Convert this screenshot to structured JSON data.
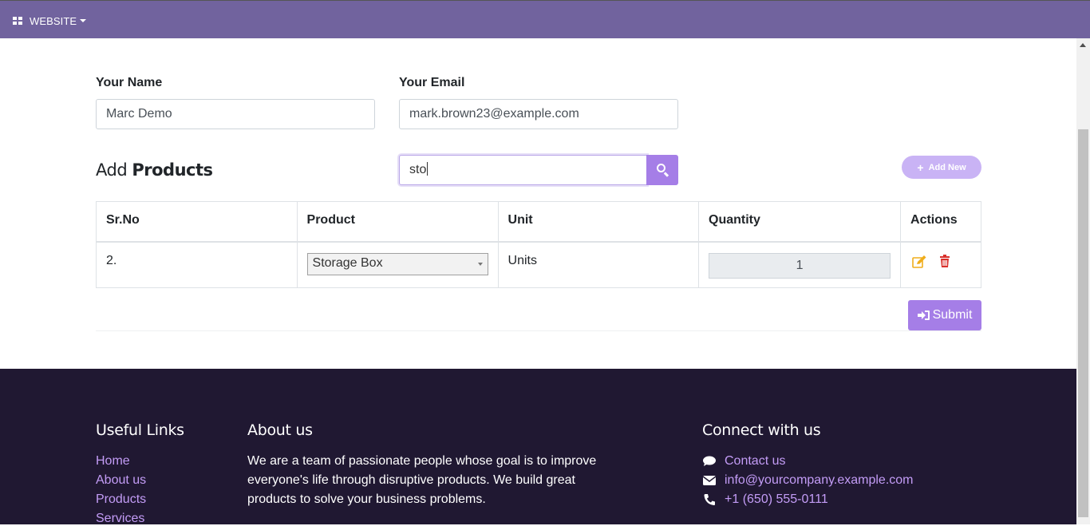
{
  "topbar": {
    "menu_label": "WEBSITE"
  },
  "form": {
    "name_label": "Your Name",
    "name_value": "Marc Demo",
    "email_label": "Your Email",
    "email_value": "mark.brown23@example.com"
  },
  "products": {
    "heading_prefix": "Add",
    "heading_bold": "Products",
    "search_value": "sto",
    "add_new_label": "Add New",
    "columns": [
      "Sr.No",
      "Product",
      "Unit",
      "Quantity",
      "Actions"
    ],
    "rows": [
      {
        "sr": "2.",
        "product": "Storage Box",
        "unit": "Units",
        "quantity": "1"
      }
    ],
    "submit_label": "Submit"
  },
  "footer": {
    "links_title": "Useful Links",
    "links": [
      "Home",
      "About us",
      "Products",
      "Services"
    ],
    "about_title": "About us",
    "about_text": "We are a team of passionate people whose goal is to improve everyone's life through disruptive products. We build great products to solve your business problems.",
    "connect_title": "Connect with us",
    "contact_label": "Contact us",
    "email": "info@yourcompany.example.com",
    "phone": "+1 (650) 555-0111"
  },
  "colors": {
    "topbar": "#71639e",
    "accent": "#a57ee7",
    "footer_bg": "#201832",
    "footer_link": "#c39cf6",
    "edit_icon": "#f0ad1b",
    "delete_icon": "#d9302b"
  }
}
